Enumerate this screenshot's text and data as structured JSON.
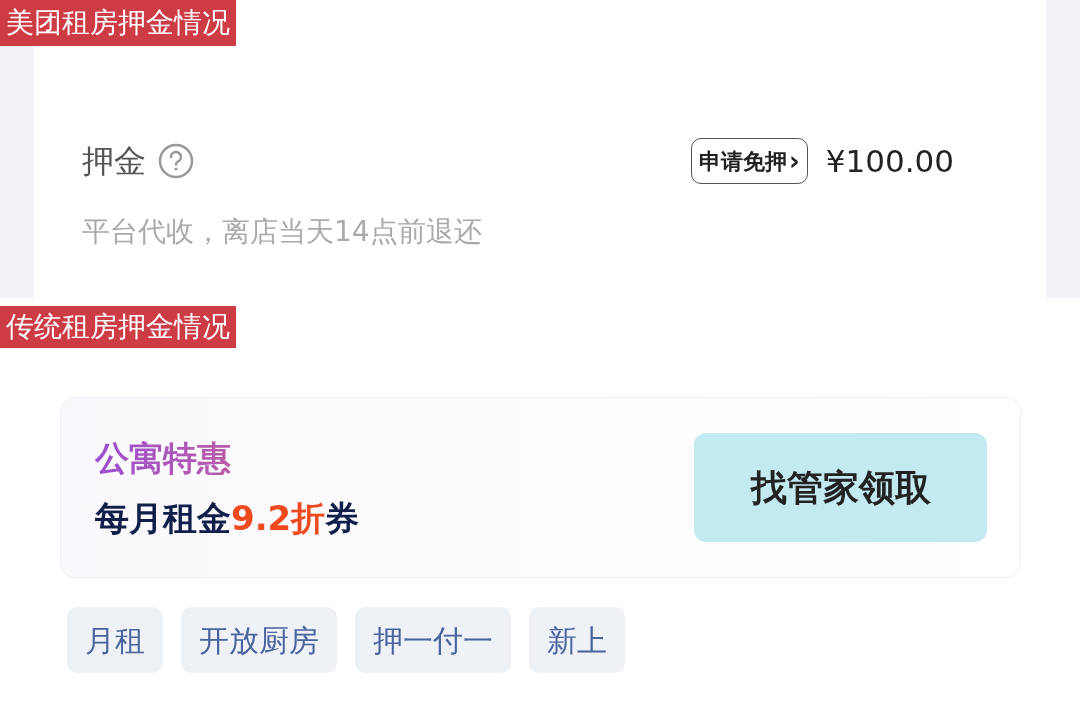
{
  "top_section": {
    "label": "美团租房押金情况",
    "deposit": {
      "title": "押金",
      "waiver_button": "申请免押",
      "waiver_chevron": "›",
      "amount": "¥100.00",
      "note": "平台代收，离店当天14点前退还"
    }
  },
  "bottom_section": {
    "label": "传统租房押金情况",
    "promo": {
      "title": "公寓特惠",
      "offer": [
        {
          "text": "每月租金",
          "highlight": false
        },
        {
          "text": "9.2折",
          "highlight": true
        },
        {
          "text": "券",
          "highlight": false
        }
      ],
      "button": "找管家领取"
    },
    "tags": [
      "月租",
      "开放厨房",
      "押一付一",
      "新上"
    ]
  }
}
